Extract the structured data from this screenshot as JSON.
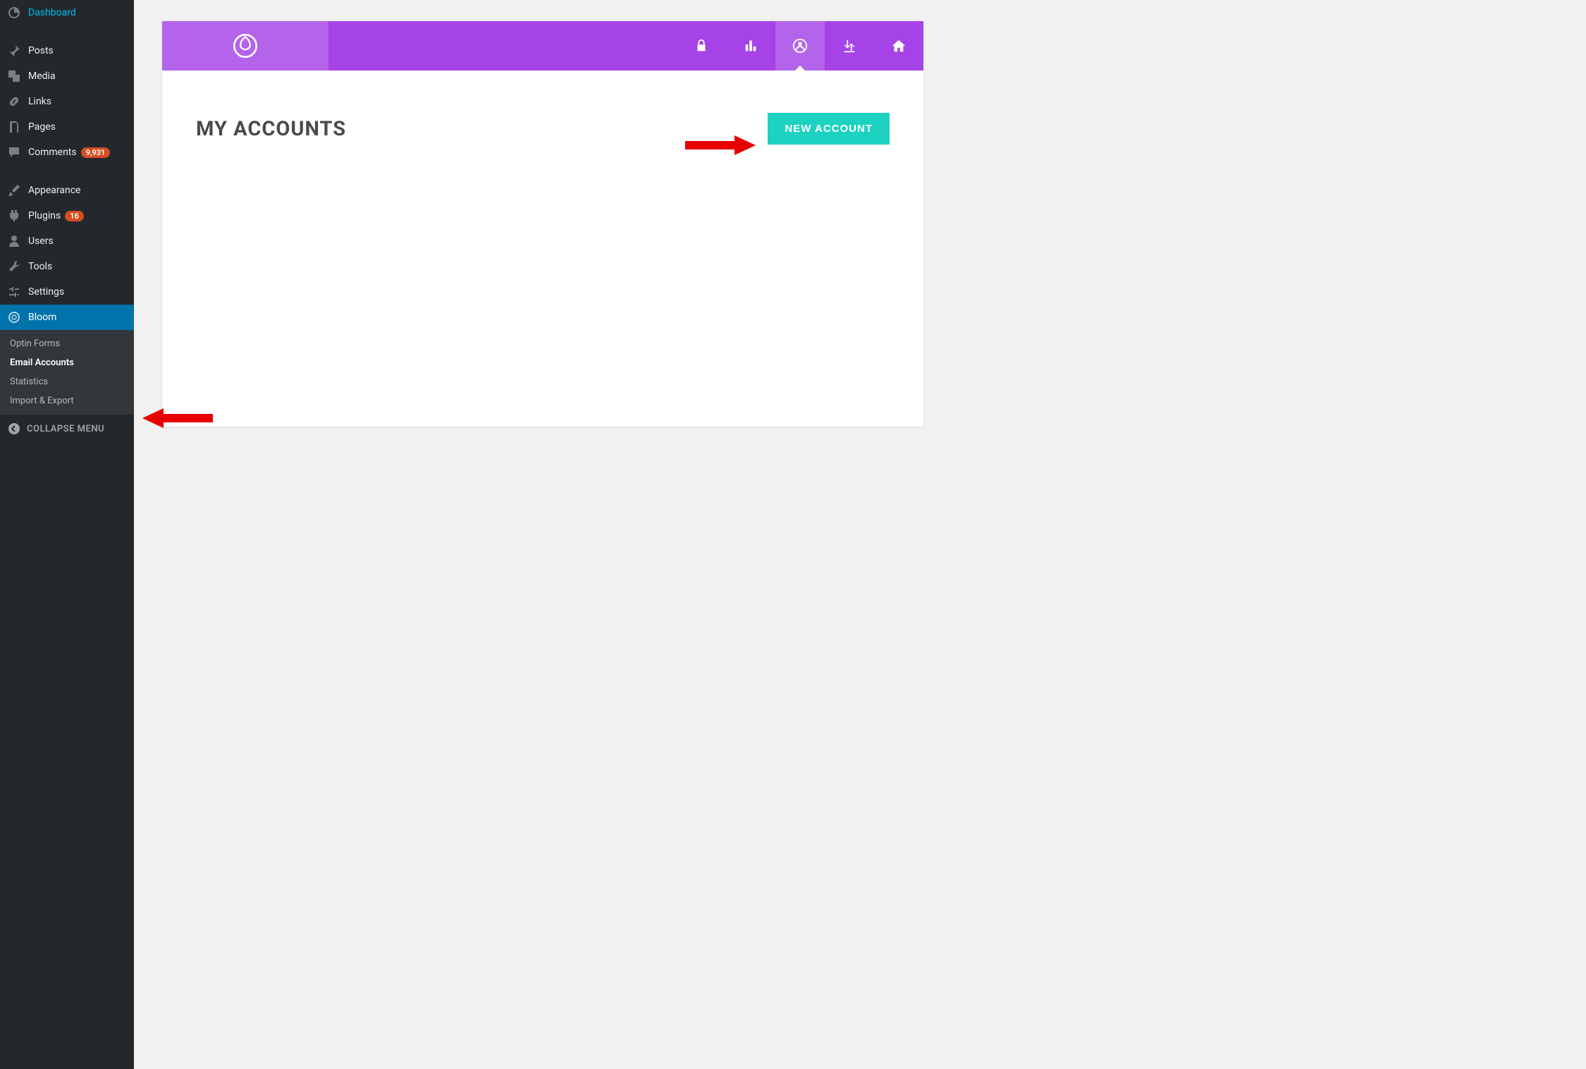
{
  "sidebar": {
    "items": [
      {
        "label": "Dashboard"
      },
      {
        "label": "Posts"
      },
      {
        "label": "Media"
      },
      {
        "label": "Links"
      },
      {
        "label": "Pages"
      },
      {
        "label": "Comments",
        "badge": "9,931"
      },
      {
        "label": "Appearance"
      },
      {
        "label": "Plugins",
        "badge": "16"
      },
      {
        "label": "Users"
      },
      {
        "label": "Tools"
      },
      {
        "label": "Settings"
      },
      {
        "label": "Bloom"
      }
    ],
    "submenu": [
      {
        "label": "Optin Forms"
      },
      {
        "label": "Email Accounts"
      },
      {
        "label": "Statistics"
      },
      {
        "label": "Import & Export"
      }
    ],
    "collapse_label": "COLLAPSE MENU"
  },
  "bloom": {
    "title": "MY ACCOUNTS",
    "new_account_label": "NEW ACCOUNT"
  }
}
